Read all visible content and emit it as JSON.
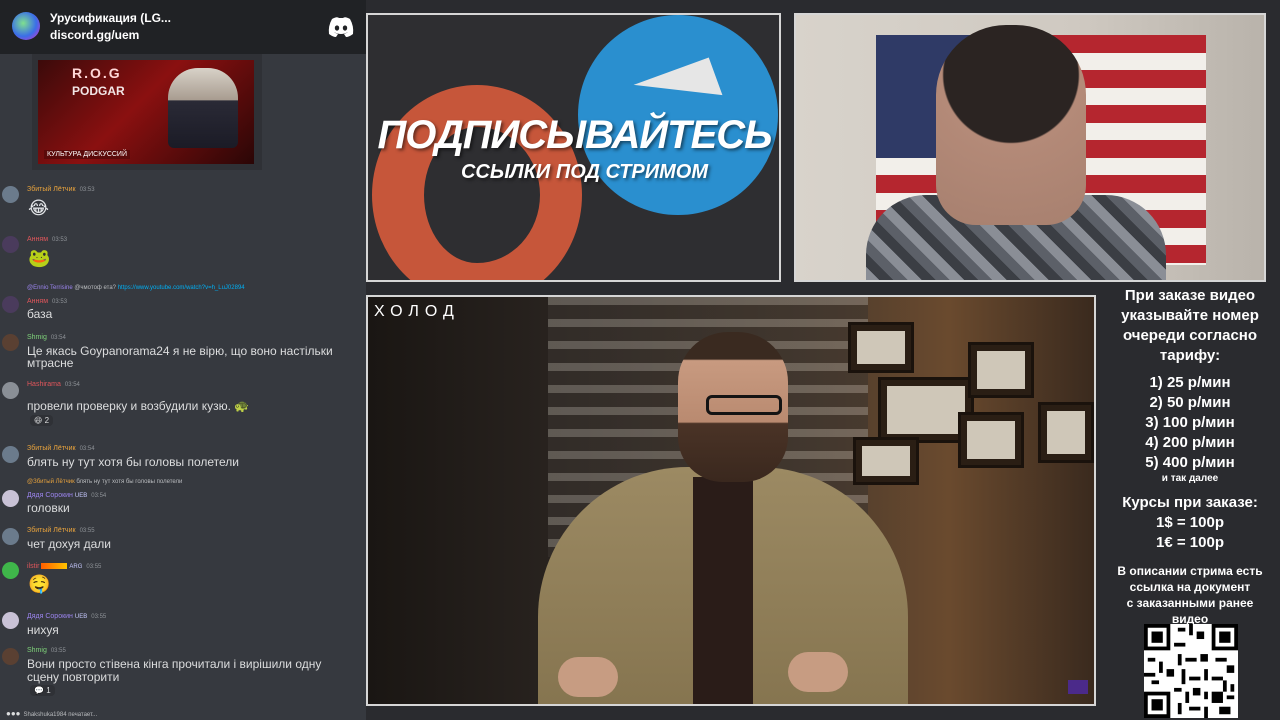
{
  "discord": {
    "server_name": "Урусификация (LG...",
    "server_invite": "discord.gg/uem",
    "embed": {
      "brand": "R.O.G",
      "subtitle": "PODGAR",
      "caption": "КУЛЬТУРА ДИСКУССИЙ"
    },
    "messages": [
      {
        "user": "Збитый Лётчик",
        "user_color": "#e8a33d",
        "time": "03:53",
        "emoji": "😂"
      },
      {
        "user": "Анням",
        "user_color": "#e0565b",
        "time": "03:53",
        "emoji": "🐸"
      },
      {
        "reply_user": "@Ennio Terrisine",
        "reply_mention": "@чмотоф",
        "reply_text": "ета?",
        "reply_link": "https://www.youtube.com/watch?v=h_LuJ02894",
        "user": "Анням",
        "user_color": "#e0565b",
        "time": "03:53",
        "text": "база"
      },
      {
        "user": "Shmig",
        "user_color": "#7fd37a",
        "time": "03:54",
        "text": "Це якась Goypanorama24 я не вірю, що воно настільки",
        "text2": "мтрасне"
      },
      {
        "user": "Hashirama",
        "user_color": "#e0565b",
        "time": "03:54",
        "text": "провели проверку и возбудили кузю. 🐢",
        "reaction_emoji": "😆",
        "reaction_count": "2"
      },
      {
        "user": "Збитый Лётчик",
        "user_color": "#e8a33d",
        "time": "03:54",
        "text": "блять ну тут хотя бы головы полетели"
      },
      {
        "reply_user": "@Збитый Лётчик",
        "reply_text": "блять ну тут хотя бы головы полетели",
        "user": "Дядя Сорокин",
        "user_color": "#9b84ee",
        "badge": "UEB",
        "time": "03:54",
        "text": "головки"
      },
      {
        "user": "Збитый Лётчик",
        "user_color": "#e8a33d",
        "time": "03:55",
        "text": "чет дохуя дали"
      },
      {
        "user": "ilstir",
        "user_color": "#e0565b",
        "badge": "ARG",
        "time": "03:55",
        "emoji": "🤤"
      },
      {
        "user": "Дядя Сорокин",
        "user_color": "#9b84ee",
        "badge": "UEB",
        "time": "03:55",
        "text": "нихуя"
      },
      {
        "user": "Shmig",
        "user_color": "#7fd37a",
        "time": "03:55",
        "text": "Вони просто стівена кінга прочитали і вирішили одну",
        "text2": "сцену повторити",
        "reaction_emoji": "💬",
        "reaction_count": "1"
      }
    ],
    "typing": "Shakshuka1984 печатает..."
  },
  "promo": {
    "title": "ПОДПИСЫВАЙТЕСЬ",
    "subtitle": "ССЫЛКИ ПОД СТРИМОМ"
  },
  "main_video": {
    "watermark": "ХОЛОД"
  },
  "info": {
    "heading": [
      "При заказе видео",
      "указывайте номер",
      "очереди согласно",
      "тарифу:"
    ],
    "prices": [
      "1) 25 р/мин",
      "2) 50 р/мин",
      "3) 100 р/мин",
      "4) 200 р/мин",
      "5) 400 р/мин"
    ],
    "etc": "и так далее",
    "rates_heading": "Курсы при заказе:",
    "rates": [
      "1$ = 100р",
      "1€ = 100р"
    ],
    "description": [
      "В описании стрима есть",
      "ссылка на документ",
      "с заказанными ранее",
      "видео"
    ]
  }
}
